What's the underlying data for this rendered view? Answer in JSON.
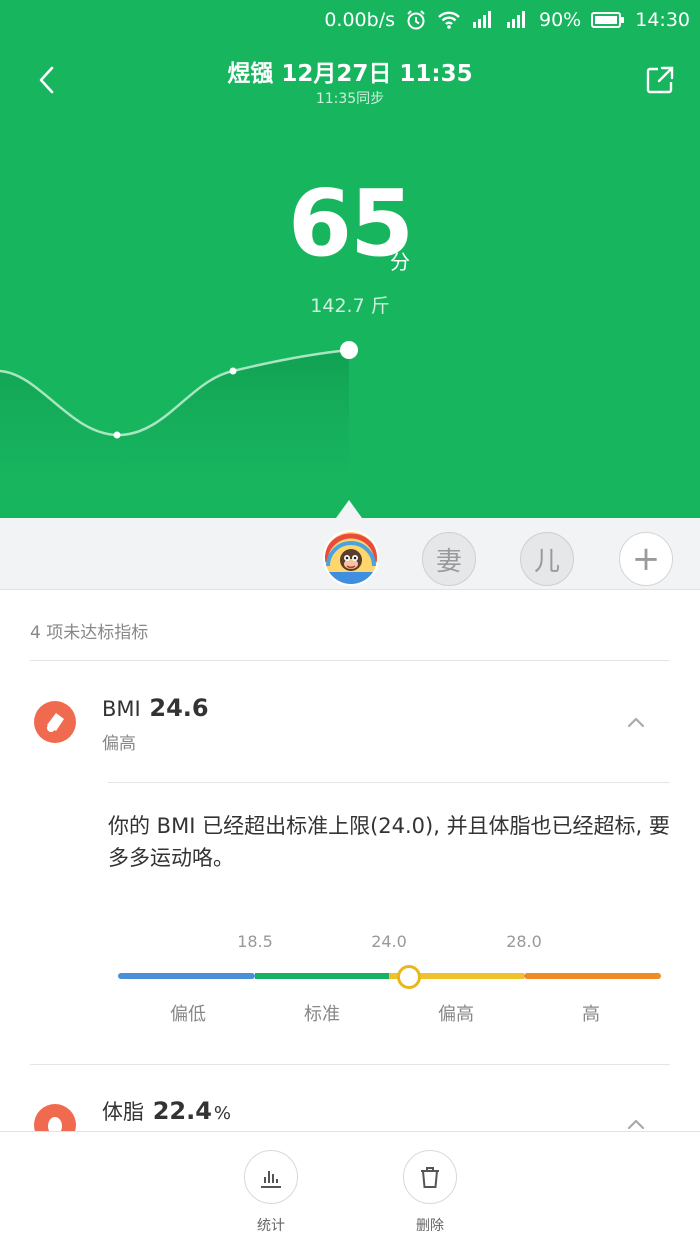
{
  "status_bar": {
    "net_speed": "0.00b/s",
    "battery": "90%",
    "time": "14:30",
    "icons": [
      "alarm-icon",
      "wifi-icon",
      "signal-icon",
      "signal-icon",
      "battery-icon"
    ]
  },
  "header": {
    "title": "煜镪 12月27日 11:35",
    "sync": "11:35同步",
    "score": "65",
    "score_unit": "分",
    "weight": "142.7 斤",
    "colors": {
      "background": "#18b55f"
    }
  },
  "profiles": {
    "items": [
      {
        "label": "妻"
      },
      {
        "label": "儿"
      },
      {
        "label": "+"
      }
    ]
  },
  "summary": {
    "title": "4 项未达标指标"
  },
  "metrics": [
    {
      "name": "BMI",
      "value": "24.6",
      "unit": "",
      "status": "偏高",
      "expanded": true,
      "description": "你的 BMI 已经超出标准上限(24.0), 并且体脂也已经超标, 要多多运动咯。",
      "scale": {
        "ticks": [
          "18.5",
          "24.0",
          "28.0"
        ],
        "labels": [
          "偏低",
          "标准",
          "偏高",
          "高"
        ],
        "colors": [
          "#4a90d9",
          "#19b265",
          "#efc12b",
          "#ef8a25"
        ]
      }
    },
    {
      "name": "体脂",
      "value": "22.4",
      "unit": "%",
      "status": "",
      "expanded": false
    }
  ],
  "toolbar": {
    "stats_label": "统计",
    "delete_label": "删除"
  }
}
